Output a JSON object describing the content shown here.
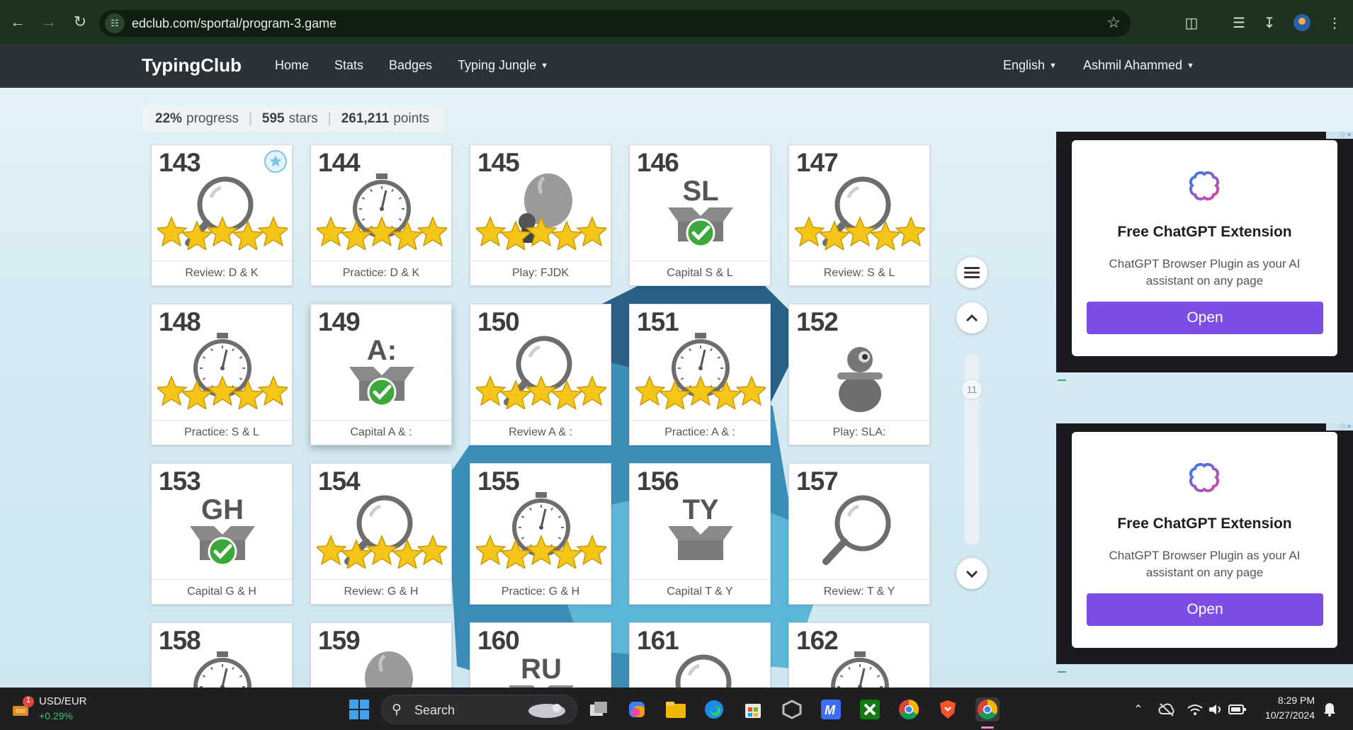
{
  "browser": {
    "url": "edclub.com/sportal/program-3.game"
  },
  "nav": {
    "logo": "TypingClub",
    "links": [
      "Home",
      "Stats",
      "Badges",
      "Typing Jungle"
    ],
    "language": "English",
    "user": "Ashmil Ahammed"
  },
  "stats": {
    "progress_value": "22%",
    "progress_label": "progress",
    "stars_value": "595",
    "stars_label": "stars",
    "points_value": "261,211",
    "points_label": "points"
  },
  "lessons": [
    {
      "num": "143",
      "label": "Review: D & K",
      "kind": "review",
      "stars": 5,
      "medal": true
    },
    {
      "num": "144",
      "label": "Practice: D & K",
      "kind": "practice",
      "stars": 5
    },
    {
      "num": "145",
      "label": "Play: FJDK",
      "kind": "play-balloon",
      "stars": 5
    },
    {
      "num": "146",
      "label": "Capital S & L",
      "kind": "capital",
      "letters": "SL",
      "done": true
    },
    {
      "num": "147",
      "label": "Review: S & L",
      "kind": "review",
      "stars": 5
    },
    {
      "num": "148",
      "label": "Practice: S & L",
      "kind": "practice",
      "stars": 5
    },
    {
      "num": "149",
      "label": "Capital A & :",
      "kind": "capital",
      "letters": "A:",
      "done": true,
      "selected": true
    },
    {
      "num": "150",
      "label": "Review A & :",
      "kind": "review",
      "stars": 5
    },
    {
      "num": "151",
      "label": "Practice: A & :",
      "kind": "practice",
      "stars": 5
    },
    {
      "num": "152",
      "label": "Play: SLA:",
      "kind": "play-pot"
    },
    {
      "num": "153",
      "label": "Capital G & H",
      "kind": "capital",
      "letters": "GH",
      "done": true
    },
    {
      "num": "154",
      "label": "Review: G & H",
      "kind": "review",
      "stars": 5
    },
    {
      "num": "155",
      "label": "Practice: G & H",
      "kind": "practice",
      "stars": 5
    },
    {
      "num": "156",
      "label": "Capital T & Y",
      "kind": "capital",
      "letters": "TY",
      "done": false
    },
    {
      "num": "157",
      "label": "Review: T & Y",
      "kind": "review",
      "stars": 0
    },
    {
      "num": "158",
      "label": "",
      "kind": "practice"
    },
    {
      "num": "159",
      "label": "",
      "kind": "play-balloon"
    },
    {
      "num": "160",
      "label": "",
      "kind": "capital",
      "letters": "RU"
    },
    {
      "num": "161",
      "label": "",
      "kind": "review"
    },
    {
      "num": "162",
      "label": "",
      "kind": "practice"
    }
  ],
  "scroll": {
    "level": "11"
  },
  "ads": [
    {
      "title": "Free ChatGPT Extension",
      "desc": "ChatGPT Browser Plugin as your AI assistant on any page",
      "button": "Open"
    },
    {
      "title": "Free ChatGPT Extension",
      "desc": "ChatGPT Browser Plugin as your AI assistant on any page",
      "button": "Open"
    }
  ],
  "taskbar": {
    "ticker_name": "USD/EUR",
    "ticker_change": "+0.29%",
    "ticker_badge": "1",
    "search_placeholder": "Search",
    "time": "8:29 PM",
    "date": "10/27/2024"
  },
  "colors": {
    "browser_bar": "#1d3320",
    "nav_bar": "#2b3237",
    "star": "#f5c518",
    "check": "#3aa83a",
    "ad_button": "#7b4fe3"
  }
}
